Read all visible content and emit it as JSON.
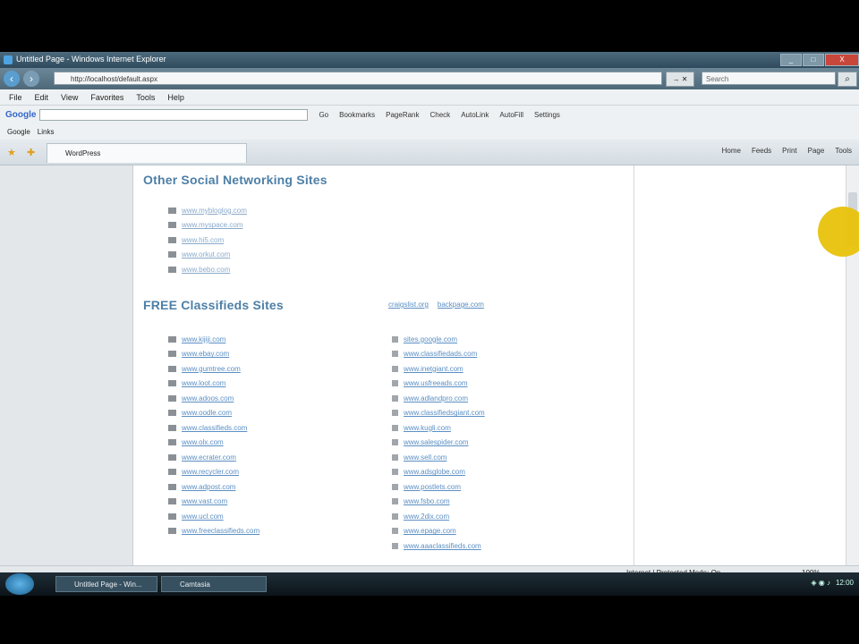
{
  "window": {
    "title": "Untitled Page - Windows Internet Explorer",
    "buttons": {
      "minimize": "_",
      "maximize": "□",
      "close": "X"
    }
  },
  "address_bar": {
    "url": "http://localhost/default.aspx",
    "go_label": "→ ✕",
    "search_placeholder": "Search"
  },
  "menu": [
    "File",
    "Edit",
    "View",
    "Favorites",
    "Tools",
    "Help"
  ],
  "google_toolbar": {
    "logo": "Google",
    "items": [
      "Go",
      "Bookmarks",
      "PageRank",
      "Check",
      "AutoLink",
      "AutoFill",
      "Settings"
    ]
  },
  "links_bar": {
    "items": [
      "Google",
      "Links"
    ]
  },
  "tabs": {
    "active_label": "WordPress",
    "commands": [
      "Home",
      "Feeds",
      "Print",
      "Page",
      "Tools"
    ]
  },
  "content": {
    "social_heading": "Other Social Networking Sites",
    "social_links": [
      "www.mybloglog.com",
      "www.myspace.com",
      "www.hi5.com",
      "www.orkut.com",
      "www.bebo.com"
    ],
    "classifieds_heading": "FREE Classifieds Sites",
    "side_links": [
      "craigslist.org",
      "backpage.com"
    ],
    "classifieds_left": [
      "www.kijiji.com",
      "www.ebay.com",
      "www.gumtree.com",
      "www.loot.com",
      "www.adoos.com",
      "www.oodle.com",
      "www.classifieds.com",
      "www.olx.com",
      "www.ecrater.com",
      "www.recycler.com",
      "www.adpost.com",
      "www.vast.com",
      "www.ucl.com",
      "www.freeclassifieds.com"
    ],
    "classifieds_right": [
      "sites.google.com",
      "www.classifiedads.com",
      "www.inetgiant.com",
      "www.usfreeads.com",
      "www.adlandpro.com",
      "www.classifiedsgiant.com",
      "www.kugli.com",
      "www.salespider.com",
      "www.sell.com",
      "www.adsglobe.com",
      "www.postlets.com",
      "www.fsbo.com",
      "www.2dix.com",
      "www.epage.com",
      "www.aaaclassifieds.com"
    ]
  },
  "status_bar": {
    "zone": "Internet | Protected Mode: On",
    "zoom": "100%"
  },
  "taskbar": {
    "buttons": [
      "Untitled Page - Win...",
      "Camtasia"
    ],
    "clock": "12:00"
  }
}
